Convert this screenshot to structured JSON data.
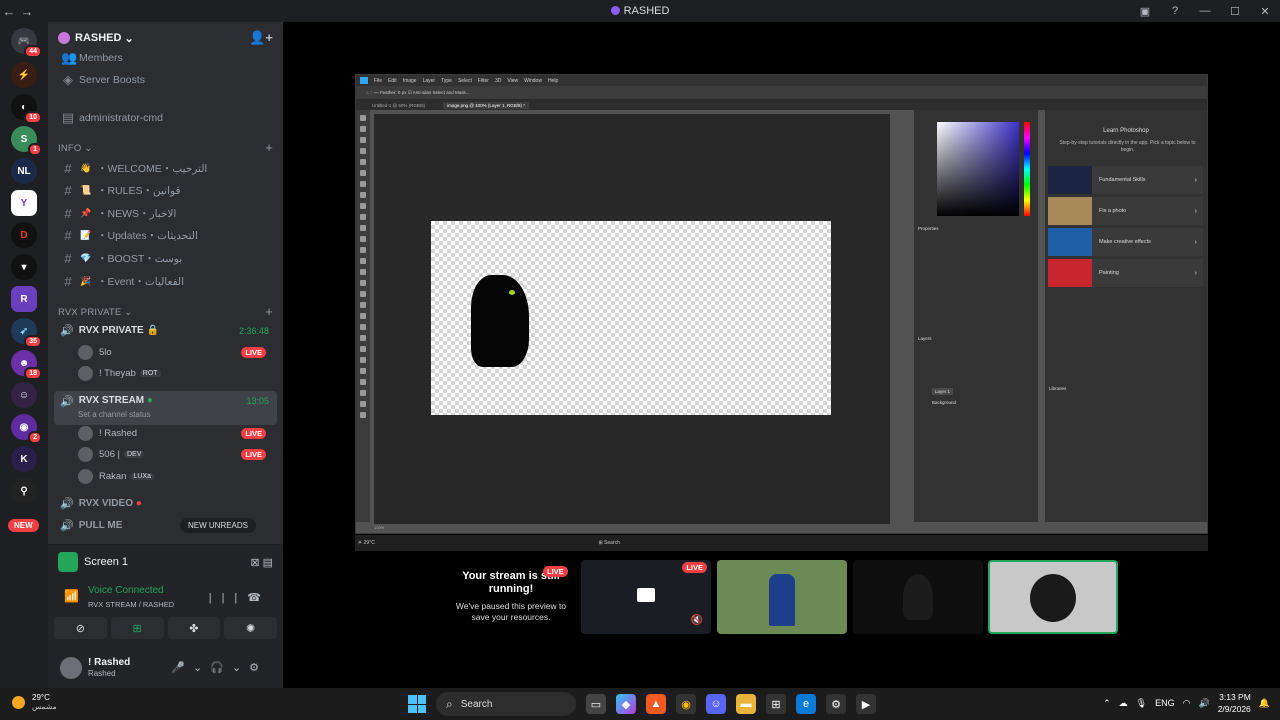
{
  "window": {
    "title": "RASHED"
  },
  "rail": {
    "badges": [
      "44",
      "10",
      "1",
      "35",
      "18",
      "2"
    ],
    "new_label": "NEW"
  },
  "guild": {
    "name": "RASHED"
  },
  "channels_top": [
    {
      "label": "Members"
    },
    {
      "label": "Server Boosts"
    },
    {
      "label": "administrator-cmd"
    }
  ],
  "categories": {
    "info": "INFO",
    "rvx_private": "RVX PRIVATE"
  },
  "info_channels": [
    {
      "label": "・WELCOME・الترحيب"
    },
    {
      "label": "・RULES・قوانين"
    },
    {
      "label": "・NEWS・الاخبار"
    },
    {
      "label": "・Updates・التحديثات"
    },
    {
      "label": "・BOOST・بوست"
    },
    {
      "label": "・Event・الفعاليات"
    }
  ],
  "voice": {
    "private": {
      "name": "RVX PRIVATE",
      "timer": "2:36:48"
    },
    "private_users": [
      {
        "name": "5lo",
        "live": "LIVE"
      },
      {
        "name": "! Theyab",
        "tag": "ROT"
      }
    ],
    "stream": {
      "name": "RVX STREAM",
      "timer": "13:05",
      "status": "Set a channel status"
    },
    "stream_users": [
      {
        "name": "! Rashed",
        "live": "LIVE"
      },
      {
        "name": "506 |",
        "tag": "DEV",
        "live": "LIVE"
      },
      {
        "name": "Rakan",
        "tag": "LUXa"
      }
    ],
    "video": {
      "name": "RVX VIDEO"
    },
    "pull": {
      "name": "PULL ME"
    }
  },
  "new_unreads": "NEW UNREADS",
  "panel": {
    "screen_label": "Screen 1",
    "connected": "Voice Connected",
    "connected_sub": "RVX STREAM / RASHED"
  },
  "user": {
    "name": "! Rashed",
    "status": "Rashed"
  },
  "photoshop": {
    "menu": [
      "File",
      "Edit",
      "Image",
      "Layer",
      "Type",
      "Select",
      "Filter",
      "3D",
      "View",
      "Window",
      "Help"
    ],
    "tabs": [
      "Untitled-1 @ 50% (RGB/8)",
      "image.png @ 100% (Layer 1, RGB/8) *"
    ],
    "status": "100%",
    "learn_title": "Learn Photoshop",
    "learn_sub": "Step-by-step tutorials directly in the app. Pick a topic below to begin.",
    "learn_items": [
      "Fundamental Skills",
      "Fix a photo",
      "Make creative effects",
      "Painting"
    ],
    "panels": [
      "Properties",
      "Layers",
      "Libraries"
    ],
    "layers": [
      "Layer 1",
      "Background"
    ]
  },
  "stream_notice": {
    "title": "Your stream is still running!",
    "body": "We've paused this preview to save your resources.",
    "live": "LIVE"
  },
  "taskbar": {
    "temp": "29°C",
    "weather": "مشمس",
    "search": "Search",
    "lang": "ENG",
    "time": "3:13 PM",
    "date": "2/9/2026"
  }
}
